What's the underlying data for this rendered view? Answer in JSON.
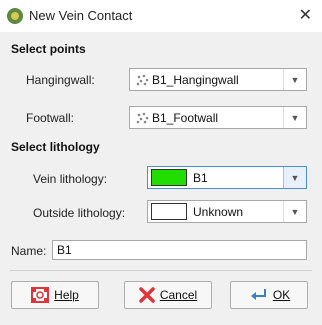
{
  "window": {
    "title": "New Vein Contact",
    "close_glyph": "✕",
    "app_icon": "leapfrog-icon"
  },
  "select_points": {
    "heading": "Select points",
    "hangingwall": {
      "label": "Hangingwall:",
      "value": "B1_Hangingwall"
    },
    "footwall": {
      "label": "Footwall:",
      "value": "B1_Footwall"
    }
  },
  "select_lithology": {
    "heading": "Select lithology",
    "vein": {
      "label": "Vein lithology:",
      "value": "B1",
      "color": "#22dd00"
    },
    "outside": {
      "label": "Outside lithology:",
      "value": "Unknown",
      "color": "#ffffff"
    }
  },
  "name": {
    "label": "Name:",
    "value": "B1"
  },
  "buttons": {
    "help": "Help",
    "cancel": "Cancel",
    "ok": "OK"
  },
  "colors": {
    "accent": "#4a90d9",
    "help_icon": "#e0343a",
    "cancel_icon": "#e0343a",
    "ok_icon": "#3b7fc4"
  }
}
